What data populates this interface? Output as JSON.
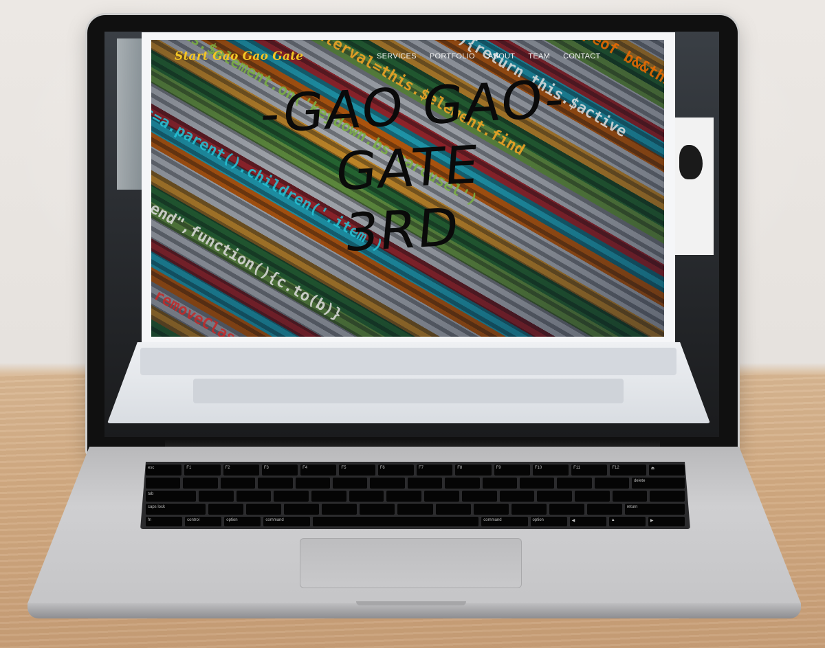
{
  "site": {
    "brand": "Start Gao Gao Gate",
    "nav": [
      "SERVICES",
      "PORTFOLIO",
      "ABOUT",
      "TEAM",
      "CONTACT"
    ],
    "hero_lines": [
      "-GAO GAO-",
      "GATE",
      "3RD"
    ]
  },
  "keyboard": {
    "row1": [
      "esc",
      "F1",
      "F2",
      "F3",
      "F4",
      "F5",
      "F6",
      "F7",
      "F8",
      "F9",
      "F10",
      "F11",
      "F12",
      "⏏"
    ],
    "row5": [
      "fn",
      "control",
      "option",
      "command",
      "",
      "command",
      "option",
      "◀",
      "▲",
      "▶"
    ],
    "left_labels": [
      "tab",
      "caps lock",
      "shift"
    ],
    "right_labels": [
      "delete",
      "return",
      "shift"
    ]
  },
  "colors": {
    "brand": "#f3c623",
    "nav_text": "#f4f4f4",
    "hero_text": "#0a0a0a"
  }
}
